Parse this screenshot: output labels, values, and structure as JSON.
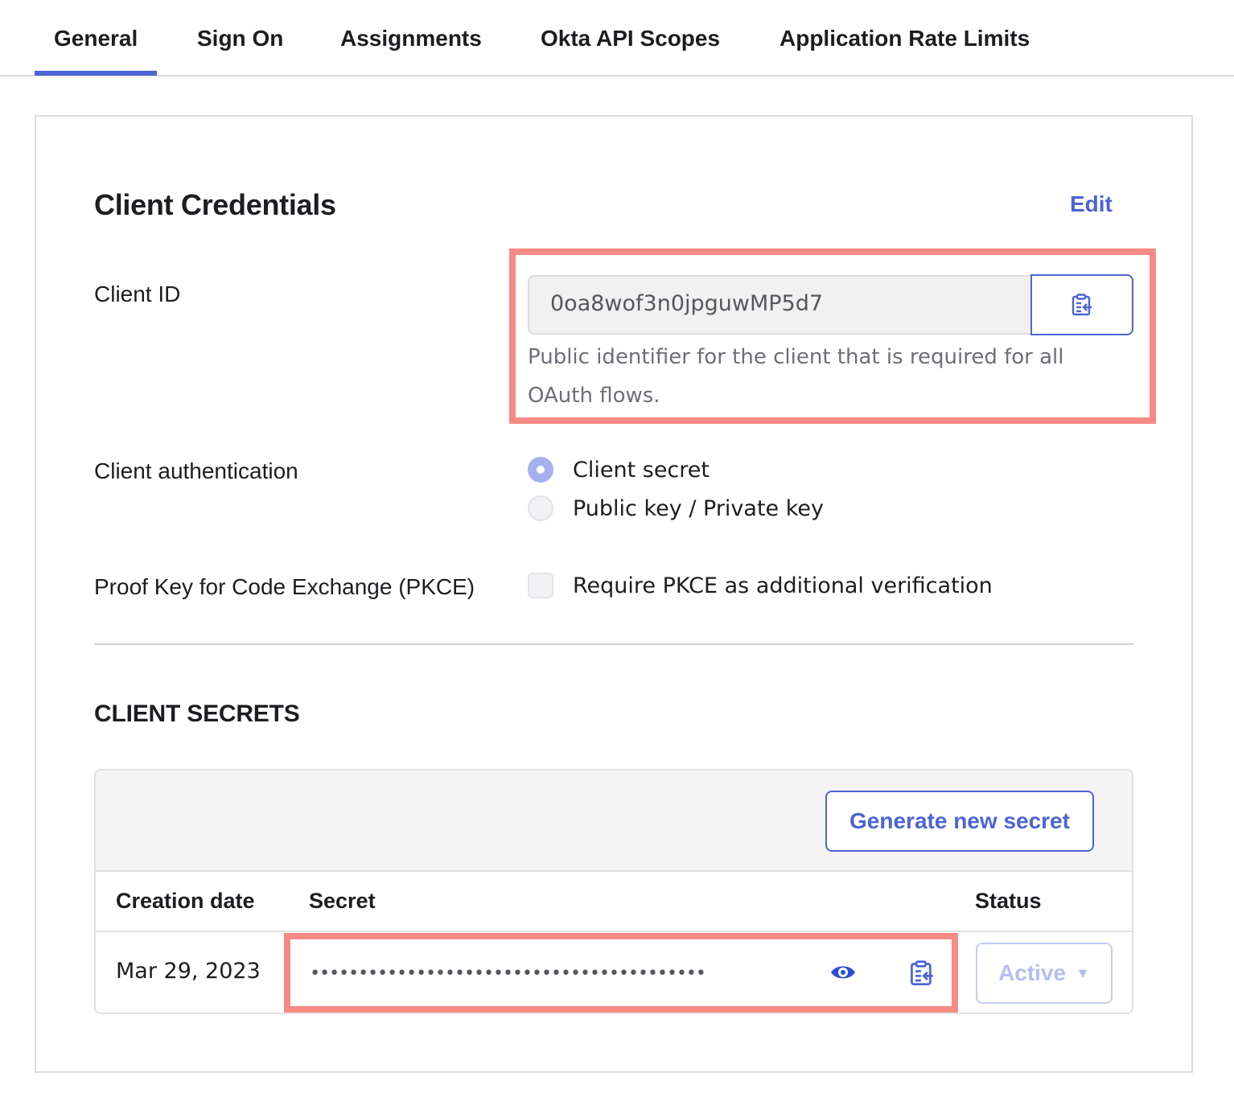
{
  "tabs": [
    {
      "label": "General",
      "active": true
    },
    {
      "label": "Sign On",
      "active": false
    },
    {
      "label": "Assignments",
      "active": false
    },
    {
      "label": "Okta API Scopes",
      "active": false
    },
    {
      "label": "Application Rate Limits",
      "active": false
    }
  ],
  "credentials": {
    "title": "Client Credentials",
    "edit_label": "Edit",
    "client_id": {
      "label": "Client ID",
      "value": "0oa8wof3n0jpguwMP5d7",
      "copy_icon": "clipboard-copy-icon",
      "hint": "Public identifier for the client that is required for all OAuth flows."
    },
    "client_auth": {
      "label": "Client authentication",
      "options": [
        {
          "label": "Client secret",
          "selected": true
        },
        {
          "label": "Public key / Private key",
          "selected": false
        }
      ]
    },
    "pkce": {
      "label": "Proof Key for Code Exchange (PKCE)",
      "checkbox_label": "Require PKCE as additional verification",
      "checked": false
    }
  },
  "secrets": {
    "title": "CLIENT SECRETS",
    "generate_label": "Generate new secret",
    "columns": [
      "Creation date",
      "Secret",
      "Status"
    ],
    "rows": [
      {
        "creation_date": "Mar 29, 2023",
        "secret_masked": "•••••••••••••••••••••••••••••••••••••••••",
        "status": "Active",
        "reveal_icon": "eye-icon",
        "copy_icon": "clipboard-copy-icon"
      }
    ]
  },
  "colors": {
    "accent": "#4c64d6",
    "highlight": "#f68a85",
    "status_disabled": "#b3bff0"
  }
}
